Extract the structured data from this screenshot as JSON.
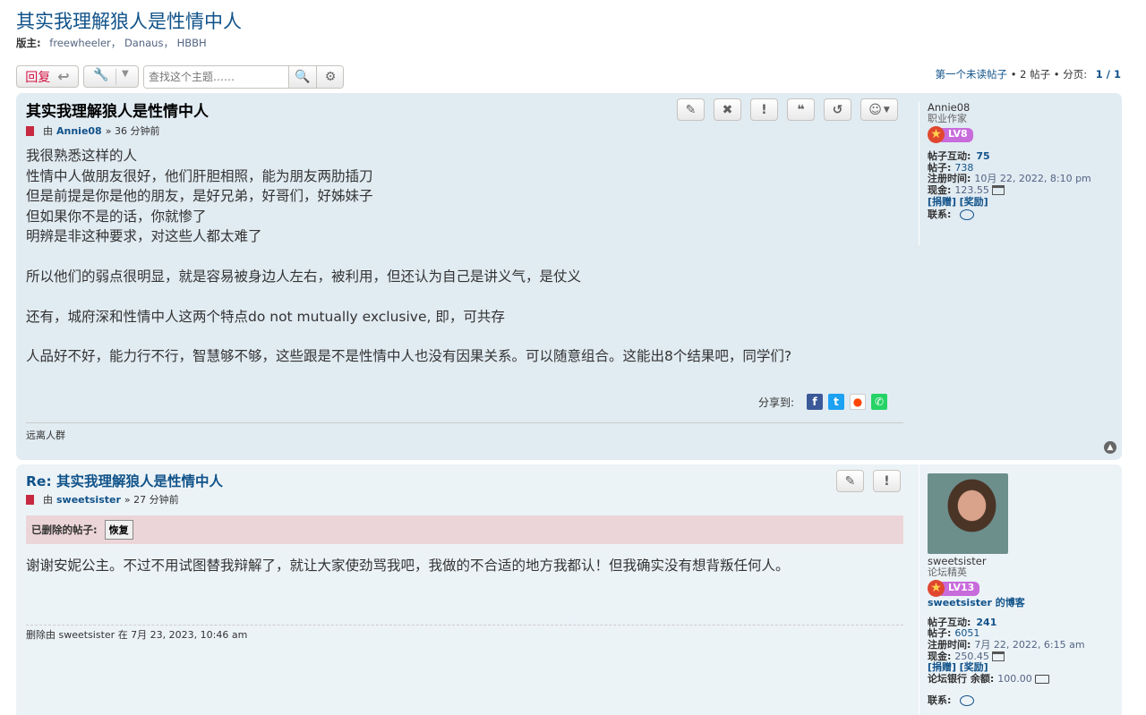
{
  "topic": {
    "title": "其实我理解狼人是性情中人",
    "moderators_label": "版主:",
    "moderators": "freewheeler， Danaus， HBBH"
  },
  "toolbar": {
    "reply_label": "回复",
    "search_placeholder": "查找这个主题……"
  },
  "pagination": {
    "first_unread": "第一个未读帖子",
    "sep": "•",
    "post_count": "2 帖子",
    "pages_label": "分页:",
    "page": "1 / 1"
  },
  "posts": [
    {
      "title": "其实我理解狼人是性情中人",
      "by": "由",
      "author": "Annie08",
      "time": "» 36 分钟前",
      "lines": [
        "我很熟悉这样的人",
        "性情中人做朋友很好，他们肝胆相照，能为朋友两肋插刀",
        "但是前提是你是他的朋友，是好兄弟，好哥们，好姊妹子",
        "但如果你不是的话，你就惨了",
        "明辨是非这种要求，对这些人都太难了"
      ],
      "para2": "所以他们的弱点很明显，就是容易被身边人左右，被利用，但还认为自己是讲义气，是仗义",
      "para3": "还有，城府深和性情中人这两个特点do not mutually exclusive, 即，可共存",
      "para4": "人品好不好，能力行不行，智慧够不够，这些跟是不是性情中人也没有因果关系。可以随意组合。这能出8个结果吧，同学们?",
      "share_label": "分享到:",
      "signature": "远离人群",
      "profile": {
        "username": "Annie08",
        "rank": "职业作家",
        "level": "LV8",
        "interactions_label": "帖子互动:",
        "interactions": "75",
        "posts_label": "帖子:",
        "posts": "738",
        "joined_label": "注册时间:",
        "joined": "10月 22, 2022, 8:10 pm",
        "cash_label": "现金:",
        "cash": "123.55",
        "donate": "[捐赠]",
        "reward": "[奖励]",
        "contact_label": "联系:"
      }
    },
    {
      "title": "Re: 其实我理解狼人是性情中人",
      "by": "由",
      "author": "sweetsister",
      "time": "» 27 分钟前",
      "deleted_label": "已删除的帖子:",
      "restore_label": "恢复",
      "body": "谢谢安妮公主。不过不用试图替我辩解了，就让大家使劲骂我吧，我做的不合适的地方我都认！但我确实没有想背叛任何人。",
      "deleted_by": "删除由 sweetsister 在 7月 23, 2023, 10:46 am",
      "profile": {
        "username": "sweetsister",
        "rank": "论坛精英",
        "level": "LV13",
        "blog_link": "sweetsister 的博客",
        "interactions_label": "帖子互动:",
        "interactions": "241",
        "posts_label": "帖子:",
        "posts": "6051",
        "joined_label": "注册时间:",
        "joined": "7月 22, 2022, 6:15 am",
        "cash_label": "现金:",
        "cash": "250.45",
        "donate": "[捐赠]",
        "reward": "[奖励]",
        "bank_label": "论坛银行 余额:",
        "bank": "100.00",
        "contact_label": "联系:"
      }
    }
  ],
  "colors": {
    "link": "#105289",
    "post1_bg": "#e1ebf2",
    "post2_bg": "#ecf3f7",
    "deleted_bg": "#ecd5d8",
    "reply_red": "#d31141"
  }
}
